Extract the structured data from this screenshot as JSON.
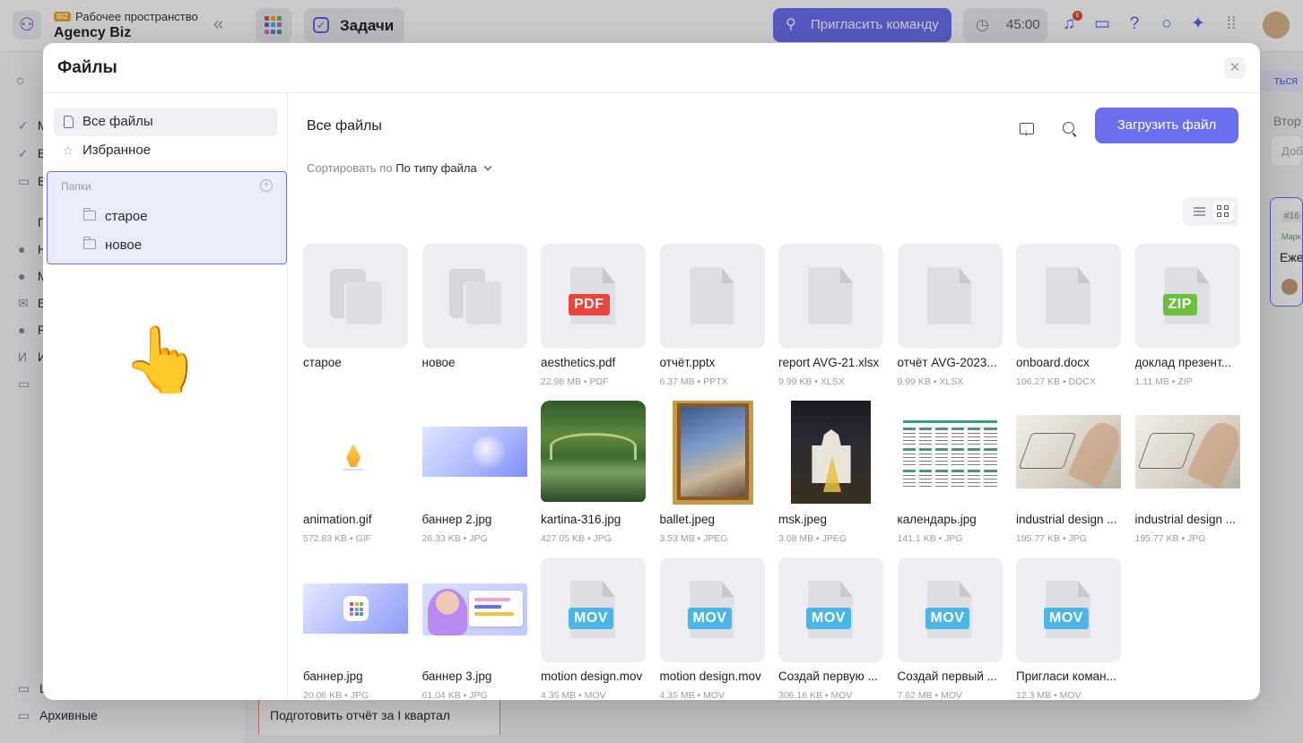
{
  "background_app": {
    "workspace_badge": "BIZ",
    "workspace_sub": "Рабочее пространство",
    "workspace_name": "Agency Biz",
    "tab_label": "Задачи",
    "invite_label": "Пригласить команду",
    "timer_value": "45:00",
    "notifications_count": "6",
    "right_button_label": "ться",
    "right_column_title": "Втор",
    "right_input_placeholder": "Доб",
    "right_card_id": "#16",
    "right_card_tag": "Марк",
    "right_card_title": "Еже",
    "sidebar_rows": [
      {
        "glyph": "✓",
        "text": "М"
      },
      {
        "glyph": "✓",
        "text": "В"
      },
      {
        "glyph": "▭",
        "text": "В"
      },
      {
        "glyph": "",
        "text": "Прое"
      },
      {
        "glyph": "●",
        "text": "Н"
      },
      {
        "glyph": "●",
        "text": "М"
      },
      {
        "glyph": "✉",
        "text": "Е"
      },
      {
        "glyph": "●",
        "text": "Р"
      },
      {
        "glyph": "И",
        "text": "И"
      },
      {
        "glyph": "▭",
        "text": ""
      }
    ],
    "bottom_rows": [
      {
        "glyph": "▭",
        "text": "Ш"
      },
      {
        "glyph": "▭",
        "text": "Архивные"
      }
    ],
    "task_row": "Подготовить отчёт за I квартал",
    "colors": {
      "accent": "#6a6ff0",
      "brand": "#5b63e6",
      "badge": "#e8453c"
    }
  },
  "modal": {
    "title": "Файлы",
    "close_glyph": "✕",
    "sidebar": {
      "all_files": "Все файлы",
      "favorites": "Избранное",
      "favorites_glyph": "☆",
      "folders_label": "Папки",
      "folders_add_glyph": "+",
      "folders": [
        "старое",
        "новое"
      ],
      "pointer_glyph": "👆"
    },
    "main": {
      "title": "Все файлы",
      "upload_label": "Загрузить файл",
      "sort_label": "Сортировать по",
      "sort_value": "По типу файла"
    },
    "files": [
      {
        "name": "старое",
        "meta": "",
        "kind": "folder"
      },
      {
        "name": "новое",
        "meta": "",
        "kind": "folder"
      },
      {
        "name": "aesthetics.pdf",
        "meta": "22.98 MB • PDF",
        "kind": "doc",
        "badge": "PDF",
        "badge_color": "#e8453c"
      },
      {
        "name": "отчёт.pptx",
        "meta": "6.37 MB • PPTX",
        "kind": "doc"
      },
      {
        "name": "report AVG-21.xlsx",
        "meta": "9.99 KB • XLSX",
        "kind": "doc"
      },
      {
        "name": "отчёт AVG-2023...",
        "meta": "9.99 KB • XLSX",
        "kind": "doc"
      },
      {
        "name": "onboard.docx",
        "meta": "106.27 KB • DOCX",
        "kind": "doc"
      },
      {
        "name": "доклад презент...",
        "meta": "1.11 MB • ZIP",
        "kind": "doc",
        "badge": "ZIP",
        "badge_color": "#6cbf3f"
      },
      {
        "name": "animation.gif",
        "meta": "572.83 KB • GIF",
        "kind": "gif"
      },
      {
        "name": "баннер 2.jpg",
        "meta": "26.33 KB • JPG",
        "kind": "banner2"
      },
      {
        "name": "kartina-316.jpg",
        "meta": "427.05 KB • JPG",
        "kind": "kartina"
      },
      {
        "name": "ballet.jpeg",
        "meta": "3.53 MB • JPEG",
        "kind": "ballet"
      },
      {
        "name": "msk.jpeg",
        "meta": "3.08 MB • JPEG",
        "kind": "msk"
      },
      {
        "name": "календарь.jpg",
        "meta": "141.1 KB • JPG",
        "kind": "calendar"
      },
      {
        "name": "industrial design ...",
        "meta": "195.77 KB • JPG",
        "kind": "industrial"
      },
      {
        "name": "industrial design ...",
        "meta": "195.77 KB • JPG",
        "kind": "industrial"
      },
      {
        "name": "баннер.jpg",
        "meta": "20.06 KB • JPG",
        "kind": "banner"
      },
      {
        "name": "баннер 3.jpg",
        "meta": "61.04 KB • JPG",
        "kind": "banner3"
      },
      {
        "name": "motion design.mov",
        "meta": "4.35 MB • MOV",
        "kind": "doc",
        "badge": "MOV",
        "badge_color": "#4ab6e8"
      },
      {
        "name": "motion design.mov",
        "meta": "4.35 MB • MOV",
        "kind": "doc",
        "badge": "MOV",
        "badge_color": "#4ab6e8"
      },
      {
        "name": "Создай первую ...",
        "meta": "306.16 KB • MOV",
        "kind": "doc",
        "badge": "MOV",
        "badge_color": "#4ab6e8"
      },
      {
        "name": "Создай первый ...",
        "meta": "7.62 MB • MOV",
        "kind": "doc",
        "badge": "MOV",
        "badge_color": "#4ab6e8"
      },
      {
        "name": "Пригласи коман...",
        "meta": "12.3 MB • MOV",
        "kind": "doc",
        "badge": "MOV",
        "badge_color": "#4ab6e8"
      }
    ]
  }
}
